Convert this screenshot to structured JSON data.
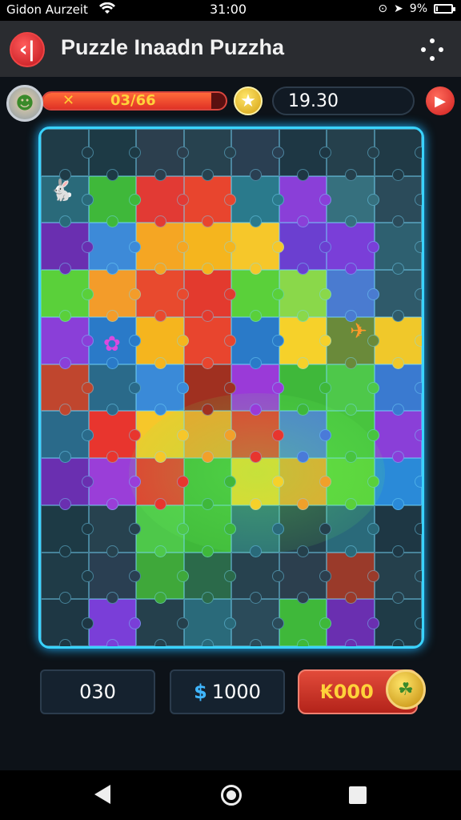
{
  "status_bar": {
    "carrier": "Gidon Aurzeit",
    "time": "31:00",
    "battery": "9%",
    "battery_level": 0.09
  },
  "app_bar": {
    "back_glyph": "‹|",
    "title": "Puzzle Inaadn Puzzha"
  },
  "hud": {
    "progress_icon": "✕",
    "progress_text": "03/66",
    "progress_fraction": 0.92,
    "timer": "19.30"
  },
  "board": {
    "columns": 8,
    "rows": 11,
    "pieces": [
      "#1f3b47",
      "#1d3a45",
      "#2c3f4e",
      "#27424f",
      "#2a3f52",
      "#1e3744",
      "#25404c",
      "#203a46",
      "#2a6a7a",
      "#3fb83a",
      "#e23a34",
      "#e8452e",
      "#2a7a8c",
      "#8a3fd8",
      "#36707e",
      "#2b4b5a",
      "#6a2fb0",
      "#3d8ad8",
      "#f5a623",
      "#f5b51e",
      "#f6c72a",
      "#6b3fd0",
      "#7a3ed8",
      "#2e6070",
      "#5ad03a",
      "#f39c2a",
      "#e84a2e",
      "#e33a2e",
      "#5ad03a",
      "#8ad84a",
      "#4a7bd0",
      "#2f5a6a",
      "#8a3fd8",
      "#2a7ac8",
      "#f5b51e",
      "#e8452e",
      "#2a7ac8",
      "#f6d12a",
      "#6a8a3a",
      "#f0c82a",
      "#c0462e",
      "#2a6a8a",
      "#3a8ad8",
      "#a03020",
      "#9a3ad8",
      "#3fb83a",
      "#4ec84a",
      "#3a7ad0",
      "#2a6a8a",
      "#e8352e",
      "#f6c72a",
      "#f2a02a",
      "#e8352e",
      "#4a7ad8",
      "#48c43e",
      "#8a3fd8",
      "#6a2fb0",
      "#9a3ed8",
      "#e8352e",
      "#3fb83a",
      "#f6d12a",
      "#f0a02a",
      "#5ad03a",
      "#2a8ad8",
      "#1d3a45",
      "#27424f",
      "#4ec84a",
      "#3fb83a",
      "#2a6a7a",
      "#25404c",
      "#2a6a7a",
      "#1e3744",
      "#1f3b47",
      "#2a3f52",
      "#3fa83a",
      "#2b6a4a",
      "#27424f",
      "#2c3f4e",
      "#9a3a2a",
      "#25404c",
      "#1e3744",
      "#7a3ed8",
      "#25404c",
      "#2a6a7a",
      "#2b4b5a",
      "#3fb83a",
      "#6a2fb0",
      "#1f3b47"
    ],
    "sprites": [
      "bunny-sprite",
      "creature-sprite",
      "plane-sprite"
    ]
  },
  "footer": {
    "counter_left": "030",
    "counter_mid_symbol": "$",
    "counter_mid": "1000",
    "buy_label": "₭000"
  }
}
